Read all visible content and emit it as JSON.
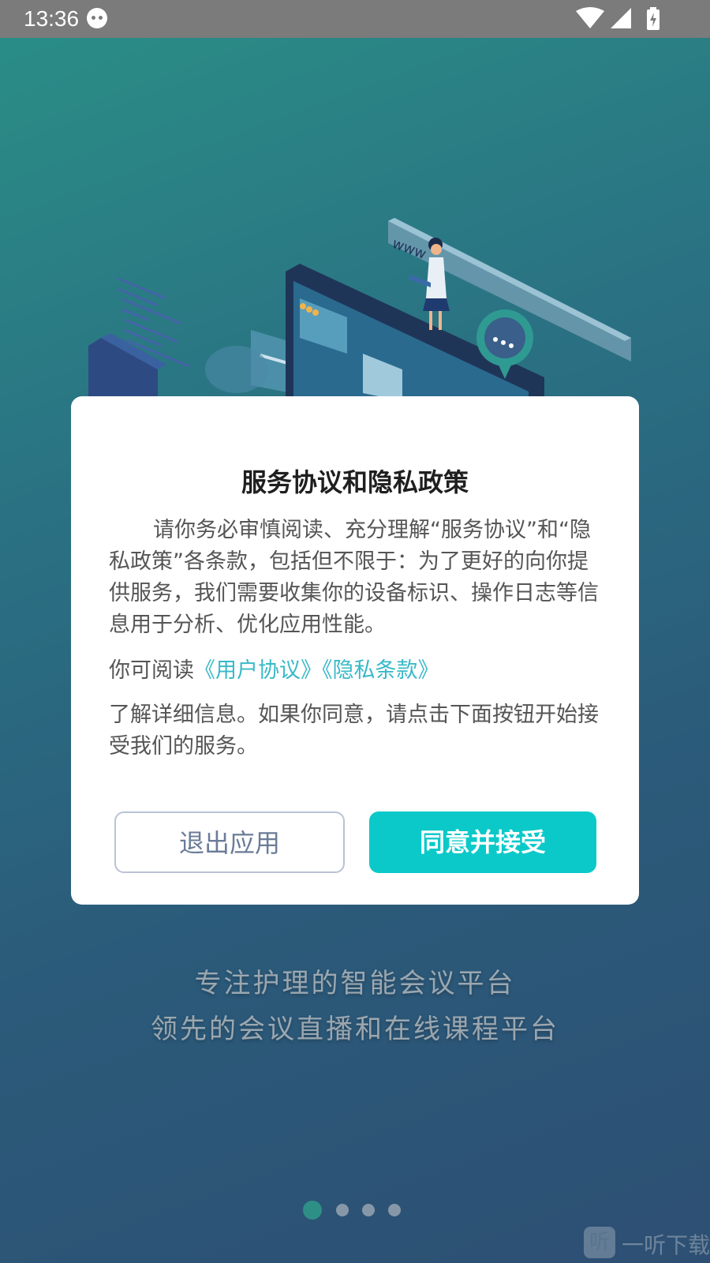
{
  "status_bar": {
    "time": "13:36"
  },
  "dialog": {
    "title": "服务协议和隐私政策",
    "paragraph1": "请你务必审慎阅读、充分理解“服务协议”和“隐私政策”各条款，包括但不限于：为了更好的向你提供服务，我们需要收集你的设备标识、操作日志等信息用于分析、优化应用性能。",
    "read_prefix": "你可阅读",
    "link_user_agreement": "《用户协议》",
    "link_privacy_terms": "《隐私条款》",
    "paragraph3": "了解详细信息。如果你同意，请点击下面按钮开始接受我们的服务。",
    "exit_button": "退出应用",
    "agree_button": "同意并接受"
  },
  "background": {
    "slogan_line1": "专注护理的智能会议平台",
    "slogan_line2": "领先的会议直播和在线课程平台"
  },
  "pager": {
    "total": 4,
    "active_index": 0
  },
  "watermark": {
    "icon_char": "听",
    "text": "一听下载"
  },
  "colors": {
    "accent": "#0bc9c9",
    "link": "#39b9c8",
    "exit_border": "#b9c2d6"
  }
}
